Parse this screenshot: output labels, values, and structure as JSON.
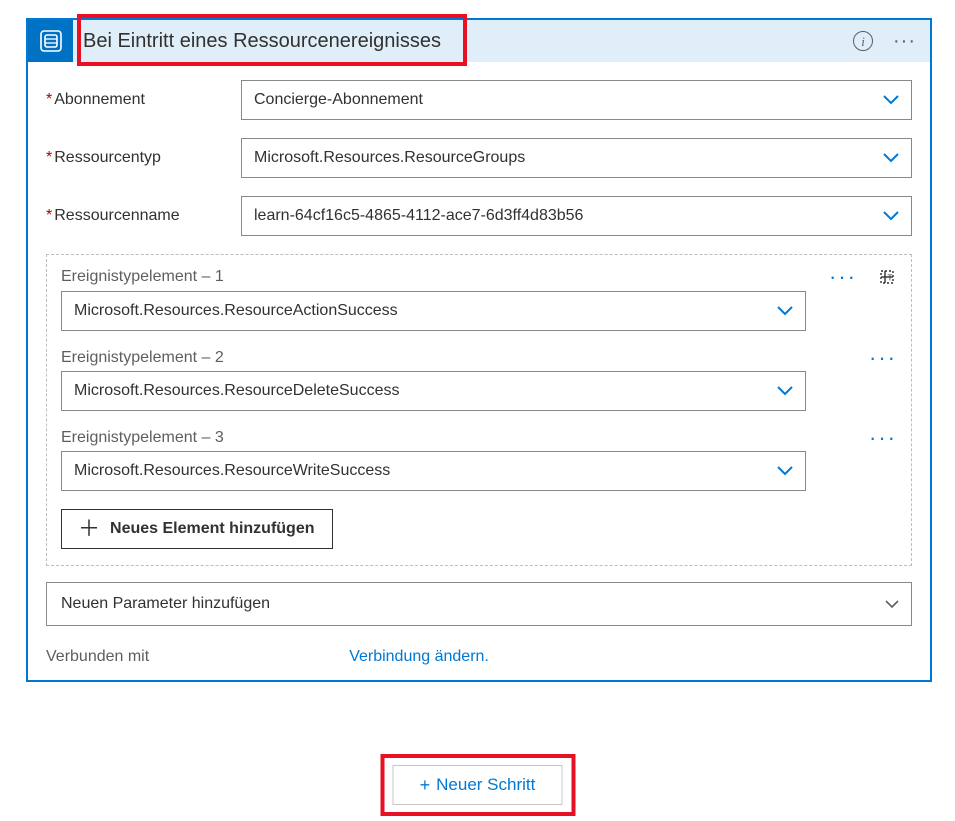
{
  "header": {
    "title": "Bei Eintritt eines Ressourcenereignisses"
  },
  "fields": {
    "subscription": {
      "label": "Abonnement",
      "value": "Concierge-Abonnement"
    },
    "resourceType": {
      "label": "Ressourcentyp",
      "value": "Microsoft.Resources.ResourceGroups"
    },
    "resourceName": {
      "label": "Ressourcenname",
      "value": "learn-64cf16c5-4865-4112-ace7-6d3ff4d83b56"
    }
  },
  "eventTypes": {
    "items": [
      {
        "label": "Ereignistypelement – 1",
        "value": "Microsoft.Resources.ResourceActionSuccess"
      },
      {
        "label": "Ereignistypelement – 2",
        "value": "Microsoft.Resources.ResourceDeleteSuccess"
      },
      {
        "label": "Ereignistypelement – 3",
        "value": "Microsoft.Resources.ResourceWriteSuccess"
      }
    ],
    "addLabel": "Neues Element hinzufügen"
  },
  "addParameter": {
    "label": "Neuen Parameter hinzufügen"
  },
  "connection": {
    "label": "Verbunden mit",
    "changeLink": "Verbindung ändern."
  },
  "newStep": {
    "label": "Neuer Schritt"
  }
}
